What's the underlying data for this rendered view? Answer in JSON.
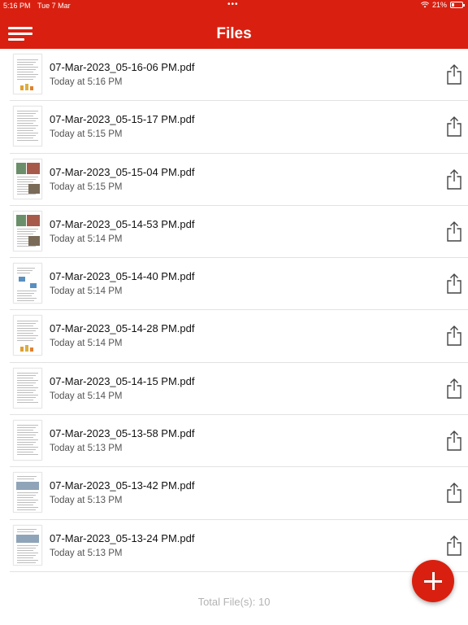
{
  "status_bar": {
    "time": "5:16 PM",
    "date": "Tue 7 Mar",
    "battery": "21%"
  },
  "header": {
    "title": "Files"
  },
  "files": [
    {
      "name": "07-Mar-2023_05-16-06 PM.pdf",
      "date": "Today at 5:16 PM",
      "thumb": "doc-with-bars"
    },
    {
      "name": "07-Mar-2023_05-15-17 PM.pdf",
      "date": "Today at 5:15 PM",
      "thumb": "doc-text"
    },
    {
      "name": "07-Mar-2023_05-15-04 PM.pdf",
      "date": "Today at 5:15 PM",
      "thumb": "doc-with-photos"
    },
    {
      "name": "07-Mar-2023_05-14-53 PM.pdf",
      "date": "Today at 5:14 PM",
      "thumb": "doc-with-photos"
    },
    {
      "name": "07-Mar-2023_05-14-40 PM.pdf",
      "date": "Today at 5:14 PM",
      "thumb": "doc-diagram"
    },
    {
      "name": "07-Mar-2023_05-14-28 PM.pdf",
      "date": "Today at 5:14 PM",
      "thumb": "doc-with-bars"
    },
    {
      "name": "07-Mar-2023_05-14-15 PM.pdf",
      "date": "Today at 5:14 PM",
      "thumb": "doc-text"
    },
    {
      "name": "07-Mar-2023_05-13-58 PM.pdf",
      "date": "Today at 5:13 PM",
      "thumb": "doc-text"
    },
    {
      "name": "07-Mar-2023_05-13-42 PM.pdf",
      "date": "Today at 5:13 PM",
      "thumb": "doc-table"
    },
    {
      "name": "07-Mar-2023_05-13-24 PM.pdf",
      "date": "Today at 5:13 PM",
      "thumb": "doc-table"
    }
  ],
  "footer": {
    "total": "Total File(s): 10"
  },
  "colors": {
    "accent": "#d92010"
  }
}
